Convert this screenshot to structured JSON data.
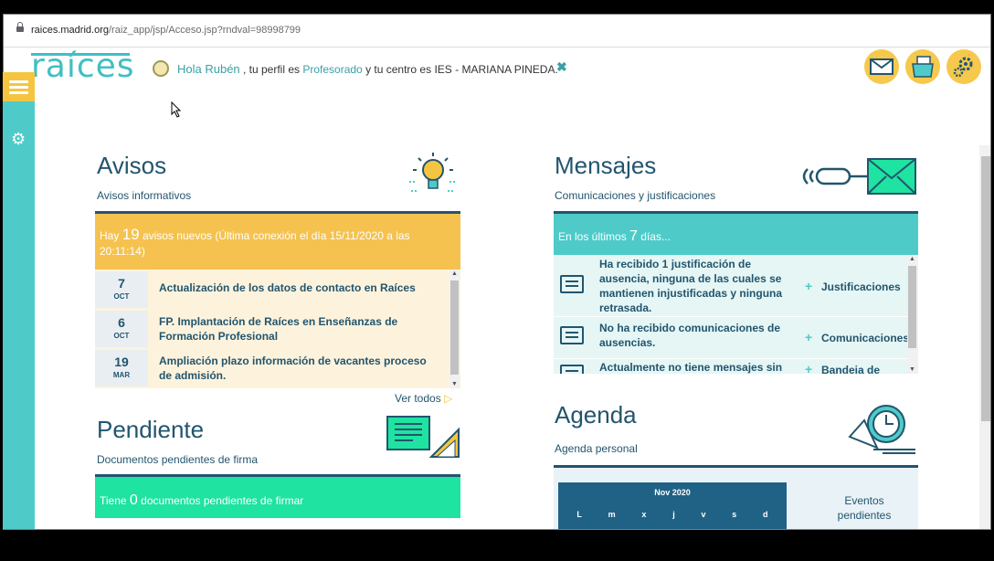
{
  "browser": {
    "url_host": "raices.madrid.org",
    "url_path": "/raiz_app/jsp/Acceso.jsp?rndval=98998799"
  },
  "header": {
    "logo": "raíces",
    "greeting_hola": "Hola Rubén",
    "greeting_mid": " , tu perfil es ",
    "profile": "Profesorado",
    "greeting_end": " y tu centro es IES - MARIANA PINEDA.",
    "close": "✖"
  },
  "avisos": {
    "title": "Avisos",
    "subtitle": "Avisos informativos",
    "banner_pre": "Hay ",
    "banner_num": "19",
    "banner_post": " avisos nuevos (Última conexión el día 15/11/2020 a las 20:11:14)",
    "items": [
      {
        "day": "7",
        "month": "OCT",
        "text": "Actualización de los datos de contacto en Raíces"
      },
      {
        "day": "6",
        "month": "OCT",
        "text": "FP. Implantación de Raíces en Enseñanzas de Formación Profesional"
      },
      {
        "day": "19",
        "month": "MAR",
        "text": "Ampliación plazo información de vacantes proceso de admisión."
      }
    ],
    "ver_todos": "Ver todos"
  },
  "pendiente": {
    "title": "Pendiente",
    "subtitle": "Documentos pendientes de firma",
    "banner_pre": "Tiene ",
    "banner_num": "0",
    "banner_post": " documentos pendientes de firmar"
  },
  "mensajes": {
    "title": "Mensajes",
    "subtitle": "Comunicaciones y justificaciones",
    "banner_pre": "En los últimos ",
    "banner_num": "7",
    "banner_post": " días...",
    "items": [
      {
        "text": "Ha recibido 1 justificación de ausencia, ninguna de las cuales se mantienen injustificadas y ninguna retrasada.",
        "link": "Justificaciones"
      },
      {
        "text": "No ha recibido comunicaciones de ausencias.",
        "link": "Comunicaciones"
      },
      {
        "text": "Actualmente no tiene mensajes sin",
        "link": "Bandeja de"
      }
    ]
  },
  "agenda": {
    "title": "Agenda",
    "subtitle": "Agenda personal",
    "month": "Nov 2020",
    "weekdays": [
      "L",
      "m",
      "x",
      "j",
      "v",
      "s",
      "d"
    ],
    "eventos": "Eventos pendientes"
  },
  "colors": {
    "teal": "#4ecbc9",
    "yellow": "#f5c541",
    "navy": "#22556e",
    "green": "#1fe3a0"
  }
}
